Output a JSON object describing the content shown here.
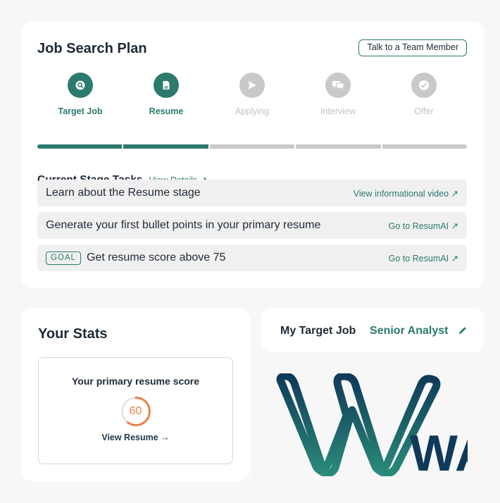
{
  "plan": {
    "title": "Job Search Plan",
    "talk_button": "Talk to a Team Member",
    "steps": [
      {
        "label": "Target Job",
        "icon": "search-icon",
        "status": "done"
      },
      {
        "label": "Resume",
        "icon": "document-icon",
        "status": "done"
      },
      {
        "label": "Applying",
        "icon": "send-icon",
        "status": "todo"
      },
      {
        "label": "Interview",
        "icon": "chat-icon",
        "status": "todo"
      },
      {
        "label": "Offer",
        "icon": "check-badge-icon",
        "status": "todo"
      }
    ],
    "progress_completed_steps": 2,
    "progress_total_steps": 5,
    "tasks_title": "Current Stage Tasks",
    "tasks_link": "View Details ↗",
    "tasks": [
      {
        "text": "Learn about the Resume stage",
        "action": "View informational video ↗",
        "goal": false
      },
      {
        "text": "Generate your first bullet points in your primary resume",
        "action": "Go to ResumAI ↗",
        "goal": false
      },
      {
        "text": "Get resume score above 75",
        "action": "Go to ResumAI ↗",
        "goal": true,
        "goal_label": "GOAL"
      }
    ]
  },
  "stats": {
    "title": "Your Stats",
    "score_label": "Your primary resume score",
    "score": "60",
    "score_value": 60,
    "score_max": 100,
    "view_resume": "View Resume →"
  },
  "target_job": {
    "label": "My Target Job",
    "value": "Senior Analyst",
    "edit_icon": "pencil-icon"
  },
  "logo": {
    "text": "WAI"
  },
  "colors": {
    "accent": "#2b7a6d",
    "inactive": "#c9c9c9",
    "score": "#e8824a",
    "logo_dark": "#0f3a5a",
    "logo_teal": "#2a8a79"
  }
}
